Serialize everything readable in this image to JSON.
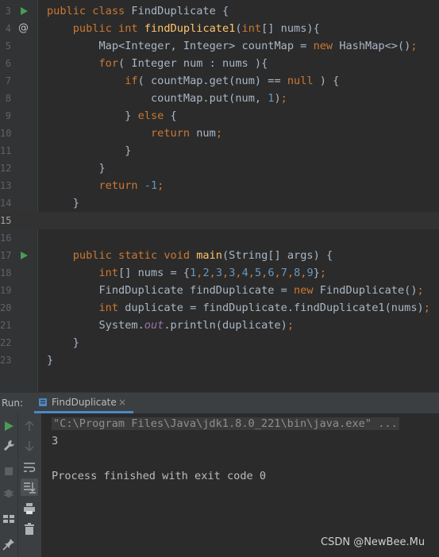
{
  "editor": {
    "lines": [
      {
        "n": "3",
        "icon": "run",
        "tokens": [
          [
            "kw",
            "public class "
          ],
          [
            "",
            "FindDuplicate {"
          ]
        ]
      },
      {
        "n": "4",
        "icon": "at",
        "tokens": [
          [
            "",
            "    "
          ],
          [
            "kw",
            "public int "
          ],
          [
            "fn",
            "findDuplicate1"
          ],
          [
            "",
            "("
          ],
          [
            "kw",
            "int"
          ],
          [
            "",
            "[] nums){"
          ]
        ]
      },
      {
        "n": "5",
        "icon": "",
        "tokens": [
          [
            "",
            "        Map<Integer, Integer> countMap = "
          ],
          [
            "kw",
            "new "
          ],
          [
            "",
            "HashMap<>()"
          ],
          [
            "kw",
            ";"
          ]
        ]
      },
      {
        "n": "6",
        "icon": "",
        "tokens": [
          [
            "",
            "        "
          ],
          [
            "kw",
            "for"
          ],
          [
            "",
            "( Integer num : nums ){"
          ]
        ]
      },
      {
        "n": "7",
        "icon": "",
        "tokens": [
          [
            "",
            "            "
          ],
          [
            "kw",
            "if"
          ],
          [
            "",
            "( countMap.get(num) == "
          ],
          [
            "kw",
            "null "
          ],
          [
            "",
            ") {"
          ]
        ]
      },
      {
        "n": "8",
        "icon": "",
        "tokens": [
          [
            "",
            "                countMap.put(num, "
          ],
          [
            "num",
            "1"
          ],
          [
            "",
            ")"
          ],
          [
            "kw",
            ";"
          ]
        ]
      },
      {
        "n": "9",
        "icon": "",
        "tokens": [
          [
            "",
            "            } "
          ],
          [
            "kw",
            "else "
          ],
          [
            "",
            "{"
          ]
        ]
      },
      {
        "n": "10",
        "icon": "",
        "tokens": [
          [
            "",
            "                "
          ],
          [
            "kw",
            "return "
          ],
          [
            "",
            "num"
          ],
          [
            "kw",
            ";"
          ]
        ]
      },
      {
        "n": "11",
        "icon": "",
        "tokens": [
          [
            "",
            "            }"
          ]
        ]
      },
      {
        "n": "12",
        "icon": "",
        "tokens": [
          [
            "",
            "        }"
          ]
        ]
      },
      {
        "n": "13",
        "icon": "",
        "tokens": [
          [
            "",
            "        "
          ],
          [
            "kw",
            "return "
          ],
          [
            "num",
            "-1"
          ],
          [
            "kw",
            ";"
          ]
        ]
      },
      {
        "n": "14",
        "icon": "",
        "tokens": [
          [
            "",
            "    }"
          ]
        ]
      },
      {
        "n": "15",
        "icon": "",
        "tokens": [],
        "current": true
      },
      {
        "n": "16",
        "icon": "",
        "tokens": []
      },
      {
        "n": "17",
        "icon": "run",
        "tokens": [
          [
            "",
            "    "
          ],
          [
            "kw",
            "public static void "
          ],
          [
            "fn",
            "main"
          ],
          [
            "",
            "(String[] args) {"
          ]
        ]
      },
      {
        "n": "18",
        "icon": "",
        "tokens": [
          [
            "",
            "        "
          ],
          [
            "kw",
            "int"
          ],
          [
            "",
            "[] nums = {"
          ],
          [
            "num",
            "1"
          ],
          [
            "kw",
            ","
          ],
          [
            "num",
            "2"
          ],
          [
            "kw",
            ","
          ],
          [
            "num",
            "3"
          ],
          [
            "kw",
            ","
          ],
          [
            "num",
            "3"
          ],
          [
            "kw",
            ","
          ],
          [
            "num",
            "4"
          ],
          [
            "kw",
            ","
          ],
          [
            "num",
            "5"
          ],
          [
            "kw",
            ","
          ],
          [
            "num",
            "6"
          ],
          [
            "kw",
            ","
          ],
          [
            "num",
            "7"
          ],
          [
            "kw",
            ","
          ],
          [
            "num",
            "8"
          ],
          [
            "kw",
            ","
          ],
          [
            "num",
            "9"
          ],
          [
            "",
            "}"
          ],
          [
            "kw",
            ";"
          ]
        ]
      },
      {
        "n": "19",
        "icon": "",
        "tokens": [
          [
            "",
            "        FindDuplicate findDuplicate = "
          ],
          [
            "kw",
            "new "
          ],
          [
            "",
            "FindDuplicate()"
          ],
          [
            "kw",
            ";"
          ]
        ]
      },
      {
        "n": "20",
        "icon": "",
        "tokens": [
          [
            "",
            "        "
          ],
          [
            "kw",
            "int "
          ],
          [
            "",
            "duplicate = findDuplicate.findDuplicate1(nums)"
          ],
          [
            "kw",
            ";"
          ]
        ]
      },
      {
        "n": "21",
        "icon": "",
        "tokens": [
          [
            "",
            "        System."
          ],
          [
            "st",
            "out"
          ],
          [
            "",
            ".println(duplicate)"
          ],
          [
            "kw",
            ";"
          ]
        ]
      },
      {
        "n": "22",
        "icon": "",
        "tokens": [
          [
            "",
            "    }"
          ]
        ]
      },
      {
        "n": "23",
        "icon": "",
        "tokens": [
          [
            "",
            "}"
          ]
        ]
      }
    ]
  },
  "run_panel": {
    "label": "Run:",
    "tab_label": "FindDuplicate",
    "tab_close": "×",
    "console": {
      "command": "\"C:\\Program Files\\Java\\jdk1.8.0_221\\bin\\java.exe\" ...",
      "output": "3",
      "finish_message": "Process finished with exit code 0"
    }
  },
  "watermark": "CSDN @NewBee.Mu",
  "colors": {
    "background": "#2b2b2b",
    "keyword": "#cc7832",
    "function": "#ffc66d",
    "number": "#6897bb",
    "static_field": "#9876aa",
    "default_text": "#a9b7c6",
    "run_green": "#499c54"
  }
}
